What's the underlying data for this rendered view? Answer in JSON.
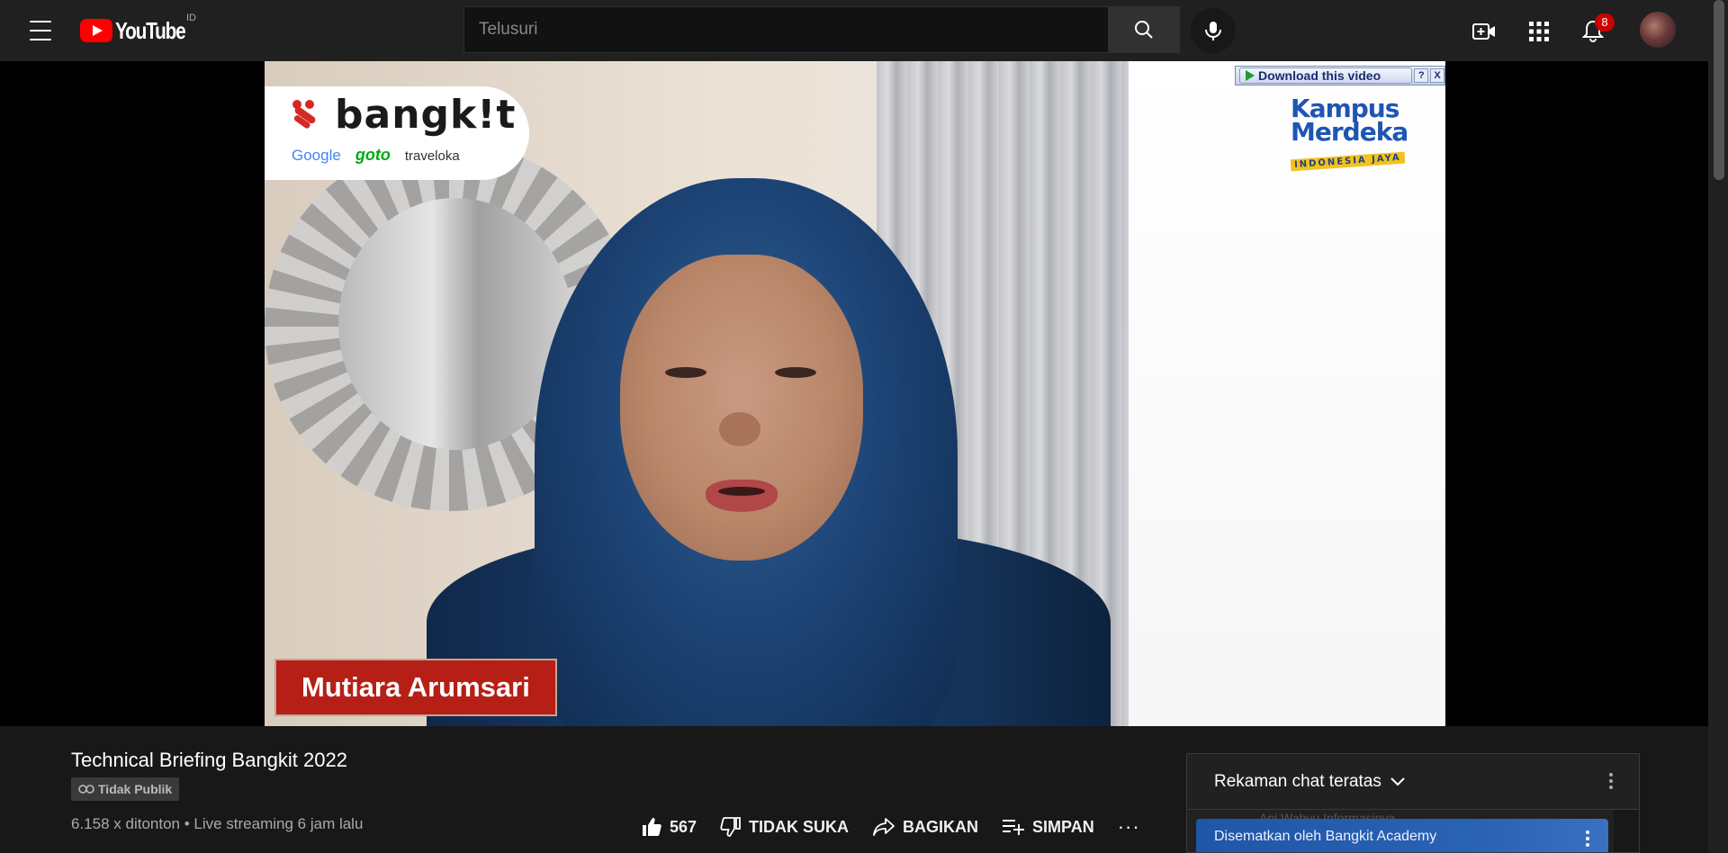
{
  "masthead": {
    "logo_text": "YouTube",
    "country_code": "ID",
    "search_placeholder": "Telusuri",
    "notification_count": "8"
  },
  "video": {
    "overlay_brand": "bangk!t",
    "partners": [
      "Google",
      "goto",
      "traveloka"
    ],
    "download_label": "Download this video",
    "download_help": "?",
    "download_close": "X",
    "kampus_line1": "Kampus",
    "kampus_line2": "Merdeka",
    "kampus_sub": "INDONESIA JAYA",
    "speaker_name": "Mutiara Arumsari"
  },
  "details": {
    "title": "Technical Briefing Bangkit 2022",
    "privacy": "Tidak Publik",
    "view_info": "6.158 x ditonton • Live streaming 6 jam lalu"
  },
  "actions": {
    "like_count": "567",
    "dislike_label": "TIDAK SUKA",
    "share_label": "BAGIKAN",
    "save_label": "SIMPAN",
    "more": "···"
  },
  "chat": {
    "mode_label": "Rekaman chat teratas",
    "ghost_message": "Ani Wahyu  Informasinya...",
    "pinned_label": "Disematkan oleh Bangkit Academy"
  },
  "colors": {
    "background": "#181818",
    "masthead": "#202020",
    "brand_red": "#ff0000",
    "badge_red": "#cc0000",
    "name_tag": "#b51f16",
    "pinned_blue": "#1f56a8"
  }
}
